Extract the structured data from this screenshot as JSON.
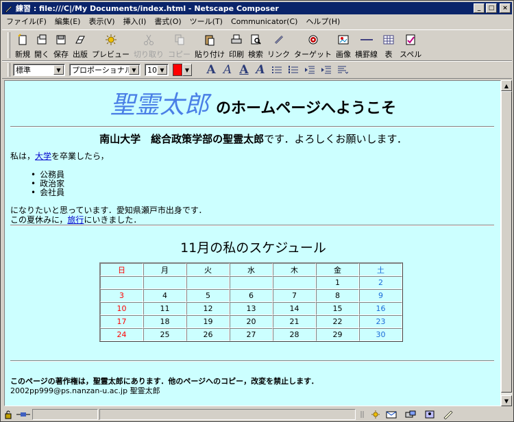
{
  "window": {
    "title": "練習 : file:///C|/My Documents/index.html - Netscape Composer",
    "minimize": "_",
    "maximize": "□",
    "close": "×"
  },
  "menu": [
    "ファイル(F)",
    "編集(E)",
    "表示(V)",
    "挿入(I)",
    "書式(O)",
    "ツール(T)",
    "Communicator(C)",
    "ヘルプ(H)"
  ],
  "toolbar": [
    {
      "label": "新規",
      "icon": "new-page-icon",
      "enabled": true
    },
    {
      "label": "開く",
      "icon": "open-icon",
      "enabled": true
    },
    {
      "label": "保存",
      "icon": "save-icon",
      "enabled": true
    },
    {
      "label": "出版",
      "icon": "publish-icon",
      "enabled": true
    },
    {
      "label": "プレビュー",
      "icon": "preview-icon",
      "enabled": true
    },
    {
      "label": "切り取り",
      "icon": "cut-icon",
      "enabled": false
    },
    {
      "label": "コピー",
      "icon": "copy-icon",
      "enabled": false
    },
    {
      "label": "貼り付け",
      "icon": "paste-icon",
      "enabled": true
    },
    {
      "label": "印刷",
      "icon": "print-icon",
      "enabled": true
    },
    {
      "label": "検索",
      "icon": "find-icon",
      "enabled": true
    },
    {
      "label": "リンク",
      "icon": "link-icon",
      "enabled": true
    },
    {
      "label": "ターゲット",
      "icon": "target-icon",
      "enabled": true
    },
    {
      "label": "画像",
      "icon": "image-icon",
      "enabled": true
    },
    {
      "label": "横罫線",
      "icon": "hrule-icon",
      "enabled": true
    },
    {
      "label": "表",
      "icon": "table-icon",
      "enabled": true
    },
    {
      "label": "スペル",
      "icon": "spell-icon",
      "enabled": true
    }
  ],
  "format": {
    "paragraph_style": "標準",
    "font": "プロポーショナル",
    "font_size": "10",
    "text_color": "#ff0000",
    "buttons": [
      {
        "icon": "font-size-larger-icon",
        "glyph": "A"
      },
      {
        "icon": "italic-a-icon",
        "glyph": "A"
      },
      {
        "icon": "underline-a-icon",
        "glyph": "A"
      },
      {
        "icon": "clear-style-icon",
        "glyph": "A"
      },
      {
        "icon": "bullet-list-icon",
        "glyph": ""
      },
      {
        "icon": "numbered-list-icon",
        "glyph": ""
      },
      {
        "icon": "outdent-icon",
        "glyph": ""
      },
      {
        "icon": "indent-icon",
        "glyph": ""
      },
      {
        "icon": "align-icon",
        "glyph": ""
      }
    ]
  },
  "page": {
    "heading_name": "聖霊太郎",
    "heading_rest": "のホームページへようこそ",
    "intro_bold": "南山大学　総合政策学部の聖霊太郎",
    "intro_rest": "です．よろしくお願いします．",
    "line1_pre": "私は，",
    "line1_link": "大学",
    "line1_post": "を卒業したら，",
    "jobs": [
      "公務員",
      "政治家",
      "会社員"
    ],
    "line2": "になりたいと思っています．愛知県瀬戸市出身です．",
    "line3_pre": "この夏休みに，",
    "line3_link": "旅行",
    "line3_post": "にいきました．",
    "calendar_title": "11月の私のスケジュール",
    "calendar": {
      "headers": [
        "日",
        "月",
        "火",
        "水",
        "木",
        "金",
        "土"
      ],
      "rows": [
        [
          "",
          "",
          "",
          "",
          "",
          "1",
          "2"
        ],
        [
          "3",
          "4",
          "5",
          "6",
          "7",
          "8",
          "9"
        ],
        [
          "10",
          "11",
          "12",
          "13",
          "14",
          "15",
          "16"
        ],
        [
          "17",
          "18",
          "19",
          "20",
          "21",
          "22",
          "23"
        ],
        [
          "24",
          "25",
          "26",
          "27",
          "28",
          "29",
          "30"
        ]
      ],
      "sunday_color": "#ff0000",
      "saturday_color": "#1a6ad8"
    },
    "copyright": "このページの著作権は，聖霊太郎にあります．他のページへのコピー，改変を禁止します．",
    "email": "2002pp999@ps.nanzan-u.ac.jp 聖霊太郎",
    "background": "#ccffff"
  }
}
